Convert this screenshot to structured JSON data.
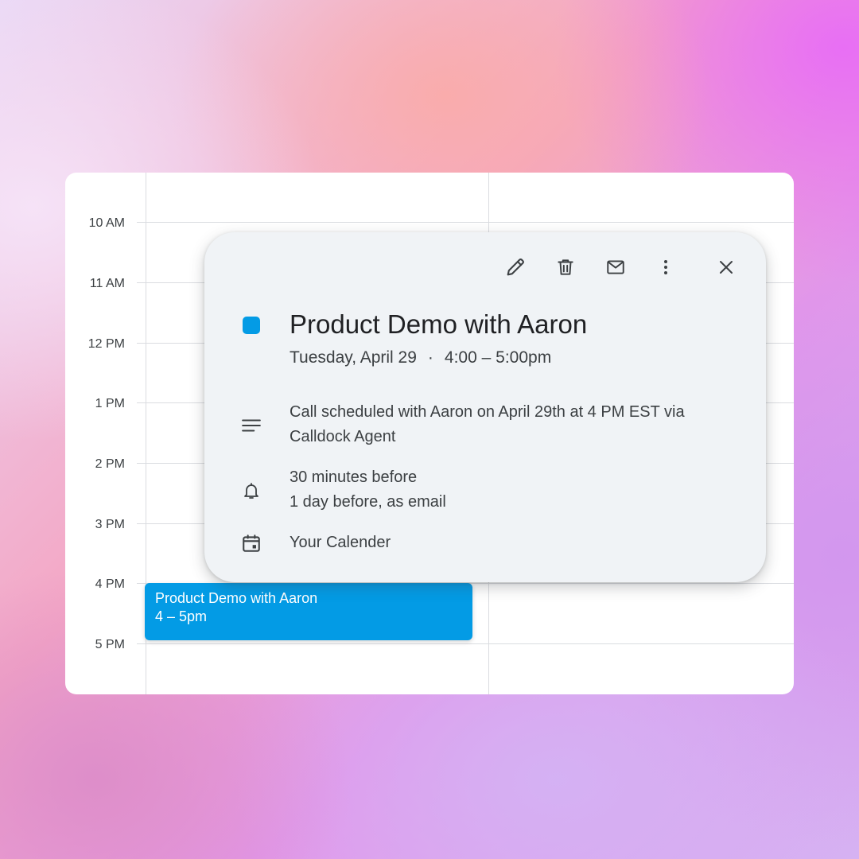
{
  "colors": {
    "event": "#039be5",
    "popup_bg": "#f0f3f6",
    "card_bg": "#ffffff",
    "icon": "#3c4043"
  },
  "calendar": {
    "hours": [
      "10 AM",
      "11 AM",
      "12 PM",
      "1 PM",
      "2 PM",
      "3 PM",
      "4 PM",
      "5 PM"
    ],
    "event_block": {
      "title": "Product Demo with Aaron",
      "time": "4 – 5pm"
    }
  },
  "popup": {
    "toolbar": {
      "edit_icon": "pencil-icon",
      "delete_icon": "trash-icon",
      "email_icon": "mail-icon",
      "more_icon": "more-vertical-icon",
      "close_icon": "close-icon"
    },
    "title": "Product Demo with Aaron",
    "date": "Tuesday, April 29",
    "separator": "·",
    "time": "4:00 – 5:00pm",
    "description": "Call scheduled with Aaron on April 29th at 4 PM EST via Calldock Agent",
    "reminders": [
      "30 minutes before",
      "1 day before, as email"
    ],
    "calendar_name": "Your Calender"
  }
}
